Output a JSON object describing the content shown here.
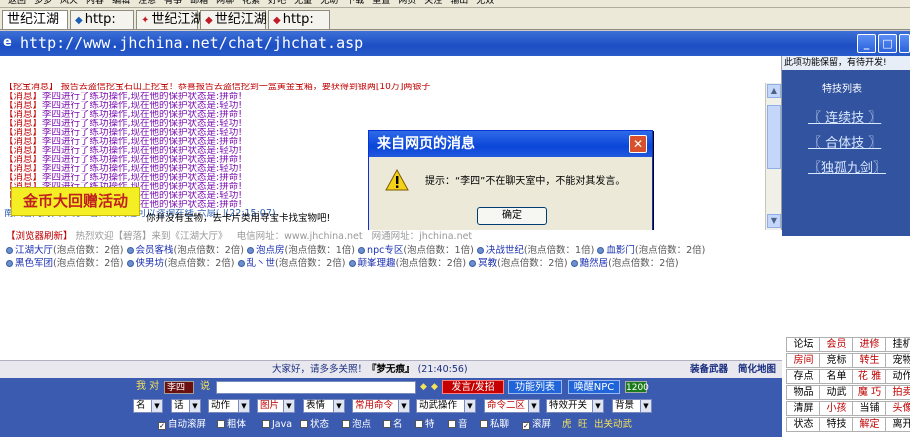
{
  "toolbar_top": [
    "返回",
    "多多",
    "风火",
    "内容",
    "编辑",
    "注意",
    "有事",
    "邮箱",
    "网聊",
    "花絮",
    "好吧",
    "无量",
    "无助",
    "下载",
    "重置",
    "网页",
    "关注",
    "输出",
    "无效"
  ],
  "tabs": [
    {
      "label": "世纪江湖"
    },
    {
      "label": "http:",
      "icon": "page-icon"
    },
    {
      "label": "世纪江湖"
    },
    {
      "label": "世纪江湖",
      "icon": "page-icon"
    },
    {
      "label": "http:"
    }
  ],
  "window": {
    "url": "http://www.jhchina.net/chat/jhchat.asp",
    "min": "_",
    "max": "□",
    "close": "X"
  },
  "chat": {
    "first_line": "【挖宝消息】 报告去盗信挖宝石山上挖宝！恭喜报告去盗信挖到一盒黄金宝箱，要获得到银两[10万]两银子",
    "tag": "【消息】",
    "lines": [
      "李四进行了练功操作,现在他的保护状态是:拼命!",
      "李四进行了练功操作,现在他的保护状态是:轻功!",
      "李四进行了练功操作,现在他的保护状态是:拼命!",
      "李四进行了练功操作,现在他的保护状态是:轻功!",
      "李四进行了练功操作,现在他的保护状态是:轻功!",
      "李四进行了练功操作,现在他的保护状态是:拼命!",
      "李四进行了练功操作,现在他的保护状态是:轻功!",
      "李四进行了练功操作,现在他的保护状态是:拼命!",
      "李四进行了练功操作,现在他的保护状态是:轻功!",
      "李四进行了练功操作,现在他的保护状态是:拼命!",
      "李四进行了练功操作,现在他的保护状态是:拼命!",
      "李四进行了练功操作,现在他的保护状态是:轻功!",
      "李四进行了练功操作,现在他的保护状态是:拼命!"
    ],
    "banner": "金币大回赠活动",
    "notice": "你并没有宝物，去卡片类用寻宝卡找宝物吧!",
    "last_line": "南风雪儿对大家说：各人有问题可以咨询在线 六扇门(22:15:07)"
  },
  "dialog": {
    "title": "来自网页的消息",
    "message": "提示：“李四”不在聊天室中，不能对其发言。",
    "ok": "确定"
  },
  "info": {
    "refresh": "【浏览器刷新】",
    "welcome": "热烈欢迎【碧落】来到《江湖大厅》",
    "site": "电信网址：www.jhchina.net",
    "site2": "网通网址：jhchina.net"
  },
  "rooms": [
    {
      "name": "江湖大厅",
      "count": "(泡点倍数：2倍)"
    },
    {
      "name": "会员客栈",
      "count": "(泡点倍数：2倍)"
    },
    {
      "name": "泡点房",
      "count": "(泡点倍数：1倍)"
    },
    {
      "name": "npc专区",
      "count": "(泡点倍数：1倍)"
    },
    {
      "name": "决战世纪",
      "count": "(泡点倍数：1倍)"
    },
    {
      "name": "血影门",
      "count": "(泡点倍数：2倍)"
    },
    {
      "name": "黑色军团",
      "count": "(泡点倍数：2倍)"
    },
    {
      "name": "侠男坊",
      "count": "(泡点倍数：2倍)"
    },
    {
      "name": "乱丶世",
      "count": "(泡点倍数：2倍)"
    },
    {
      "name": "颠峯理趣",
      "count": "(泡点倍数：2倍)"
    },
    {
      "name": "冥教",
      "count": "(泡点倍数：2倍)"
    },
    {
      "name": "黯然居",
      "count": "(泡点倍数：2倍)"
    }
  ],
  "status": {
    "greet": "大家好，请多多关照！",
    "name": "『梦无痕』",
    "time": "(21:40:56)",
    "right1": "装备武器",
    "right2": "简化地图"
  },
  "controls": {
    "me_label": "我 对",
    "nick": "李四",
    "say_label": "说",
    "send": "发言/发招",
    "func_list": "功能列表",
    "wake": "唤醒NPC",
    "count": "1200",
    "selects": [
      "名",
      "话",
      "动作",
      "图片",
      "表情",
      "常用命令",
      "动武操作",
      "命令二区",
      "特效开关",
      "背景"
    ],
    "checks": [
      "自动滚屏",
      "粗体",
      "Java",
      "状态",
      "泡点",
      "名",
      "特",
      "音",
      "私聊",
      "滚屏",
      "虎",
      "旺",
      "出关动武"
    ]
  },
  "right": {
    "top": "此项功能保留，有待开发!",
    "head": "特技列表",
    "skills": [
      "〖 连续技 〗",
      "〖 合体技 〗",
      "〖独孤九剑〗"
    ],
    "grid": [
      [
        "论坛",
        "会员",
        "进修",
        "挂机"
      ],
      [
        "房间",
        "竞标",
        "转生",
        "宠物"
      ],
      [
        "存点",
        "名单",
        "花 雅",
        "动作"
      ],
      [
        "物品",
        "动武",
        "魔 巧",
        "拍卖"
      ],
      [
        "清屏",
        "小孩",
        "当铺",
        "头像"
      ],
      [
        "状态",
        "特技",
        "解定",
        "离开"
      ]
    ]
  },
  "colors": {
    "accent": "#3b5bb0",
    "title": "#1c4fc4",
    "red": "#c00000",
    "banner": "#f4ee24"
  }
}
